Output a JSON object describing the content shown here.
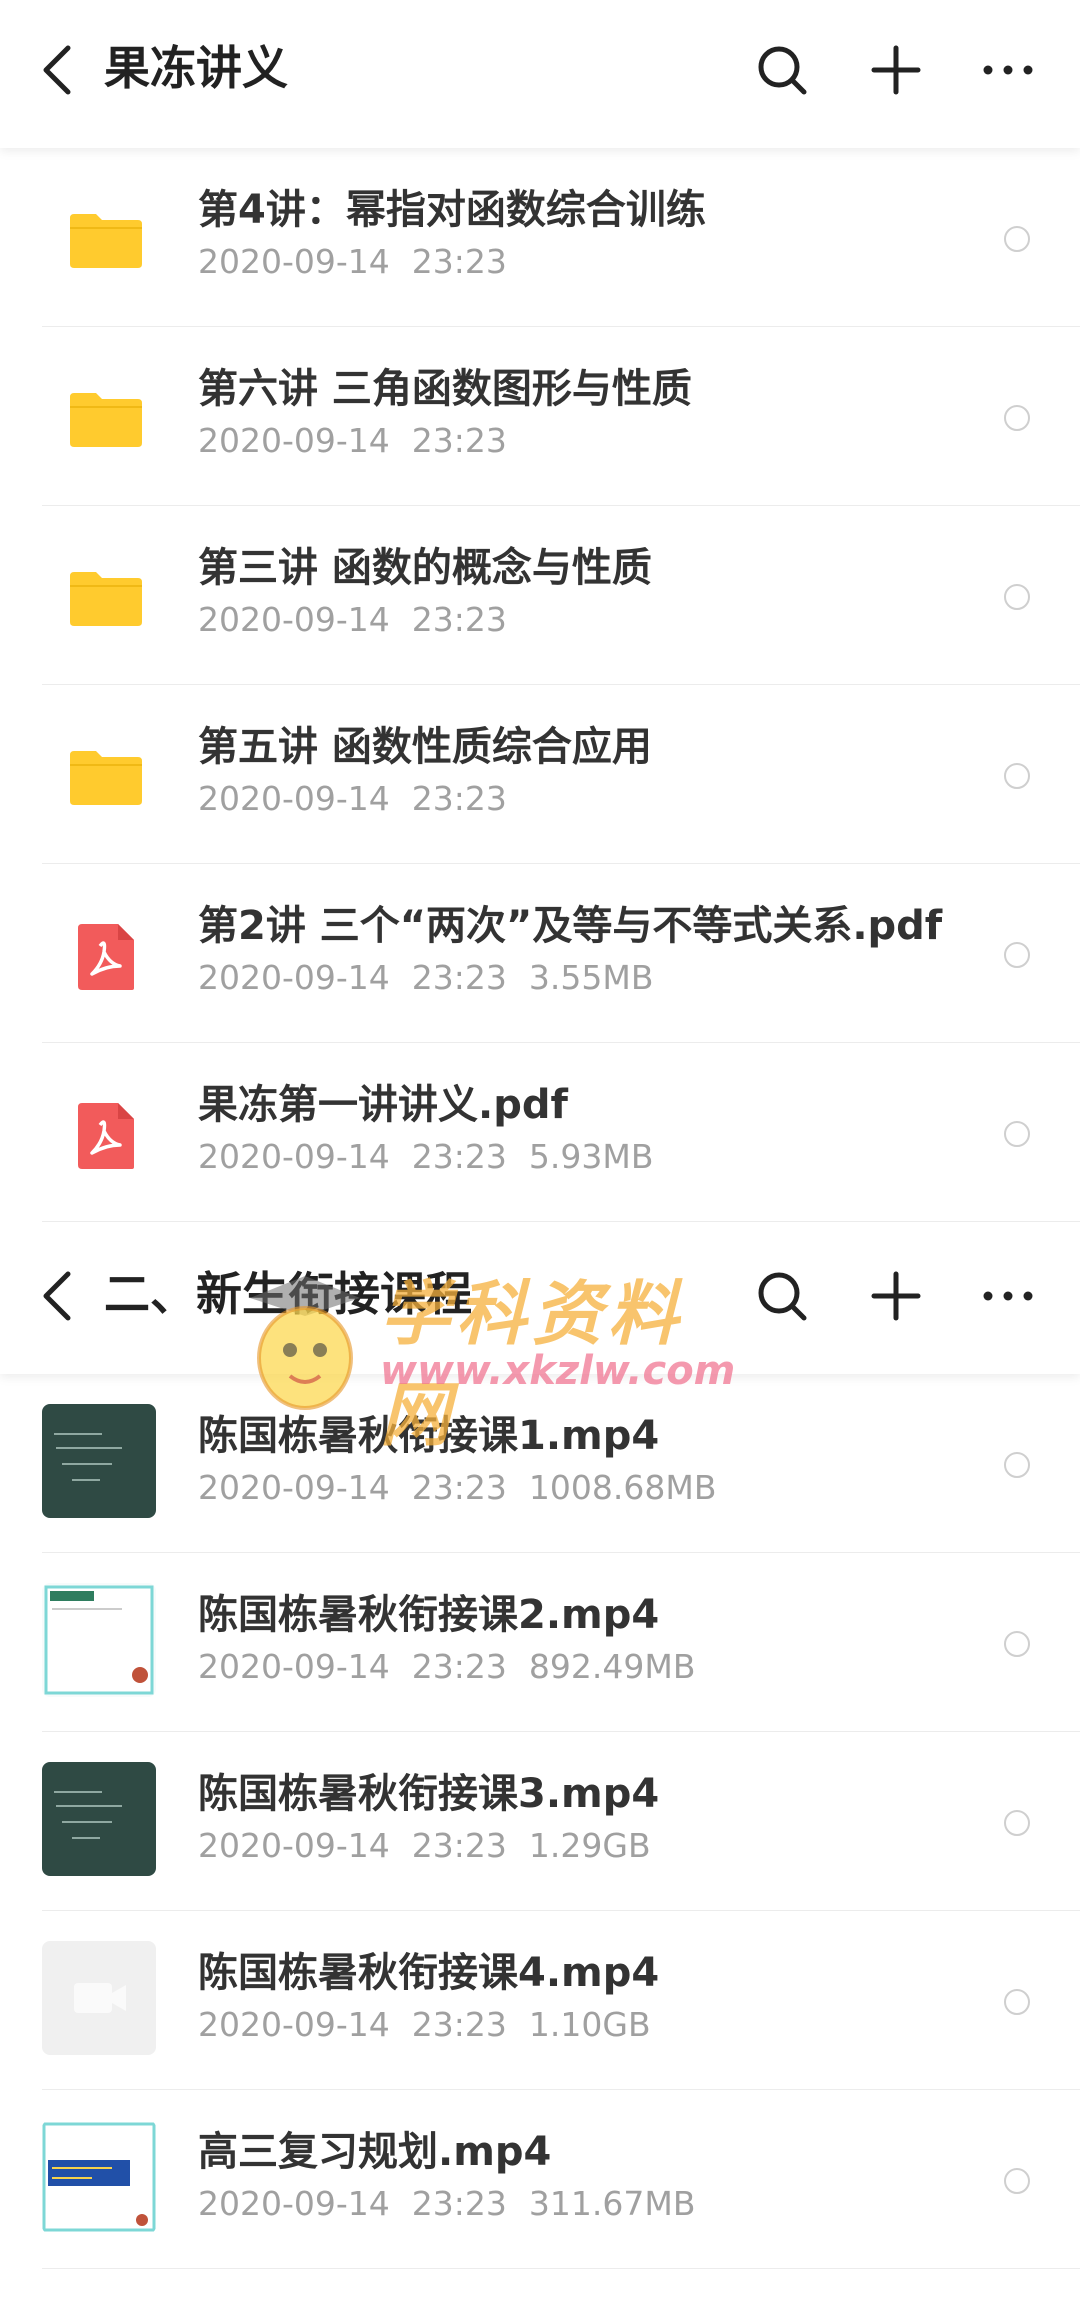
{
  "screen_a": {
    "header": {
      "title": "果冻讲义"
    },
    "items": [
      {
        "type": "folder",
        "name": "第4讲：幂指对函数综合训练",
        "date": "2020-09-14",
        "time": "23:23",
        "size": ""
      },
      {
        "type": "folder",
        "name": "第六讲 三角函数图形与性质",
        "date": "2020-09-14",
        "time": "23:23",
        "size": ""
      },
      {
        "type": "folder",
        "name": "第三讲 函数的概念与性质",
        "date": "2020-09-14",
        "time": "23:23",
        "size": ""
      },
      {
        "type": "folder",
        "name": "第五讲 函数性质综合应用",
        "date": "2020-09-14",
        "time": "23:23",
        "size": ""
      },
      {
        "type": "pdf",
        "name": "第2讲 三个“两次”及等与不等式关系.pdf",
        "date": "2020-09-14",
        "time": "23:23",
        "size": "3.55MB"
      },
      {
        "type": "pdf",
        "name": "果冻第一讲讲义.pdf",
        "date": "2020-09-14",
        "time": "23:23",
        "size": "5.93MB"
      }
    ]
  },
  "screen_b": {
    "header": {
      "title": "二、新生衔接课程"
    },
    "items": [
      {
        "type": "video",
        "thumb": "chalkboard",
        "name": "陈国栋暑秋衔接课1.mp4",
        "date": "2020-09-14",
        "time": "23:23",
        "size": "1008.68MB"
      },
      {
        "type": "video",
        "thumb": "slide",
        "name": "陈国栋暑秋衔接课2.mp4",
        "date": "2020-09-14",
        "time": "23:23",
        "size": "892.49MB"
      },
      {
        "type": "video",
        "thumb": "chalkboard",
        "name": "陈国栋暑秋衔接课3.mp4",
        "date": "2020-09-14",
        "time": "23:23",
        "size": "1.29GB"
      },
      {
        "type": "video",
        "thumb": "placeholder",
        "name": "陈国栋暑秋衔接课4.mp4",
        "date": "2020-09-14",
        "time": "23:23",
        "size": "1.10GB"
      },
      {
        "type": "video",
        "thumb": "slide-blue",
        "name": "高三复习规划.mp4",
        "date": "2020-09-14",
        "time": "23:23",
        "size": "311.67MB"
      }
    ]
  },
  "watermark": {
    "cn": "学科资料网",
    "url": "www.xkzlw.com"
  },
  "icons": {
    "back": "chevron-left-icon",
    "search": "search-icon",
    "add": "plus-icon",
    "more": "more-horizontal-icon",
    "folder": "folder-icon",
    "pdf": "pdf-icon",
    "radio": "radio-unchecked-icon"
  },
  "colors": {
    "folder": "#FFCB2E",
    "pdf": "#F25B5B",
    "meta": "#A0A0A0",
    "title": "#222222"
  }
}
